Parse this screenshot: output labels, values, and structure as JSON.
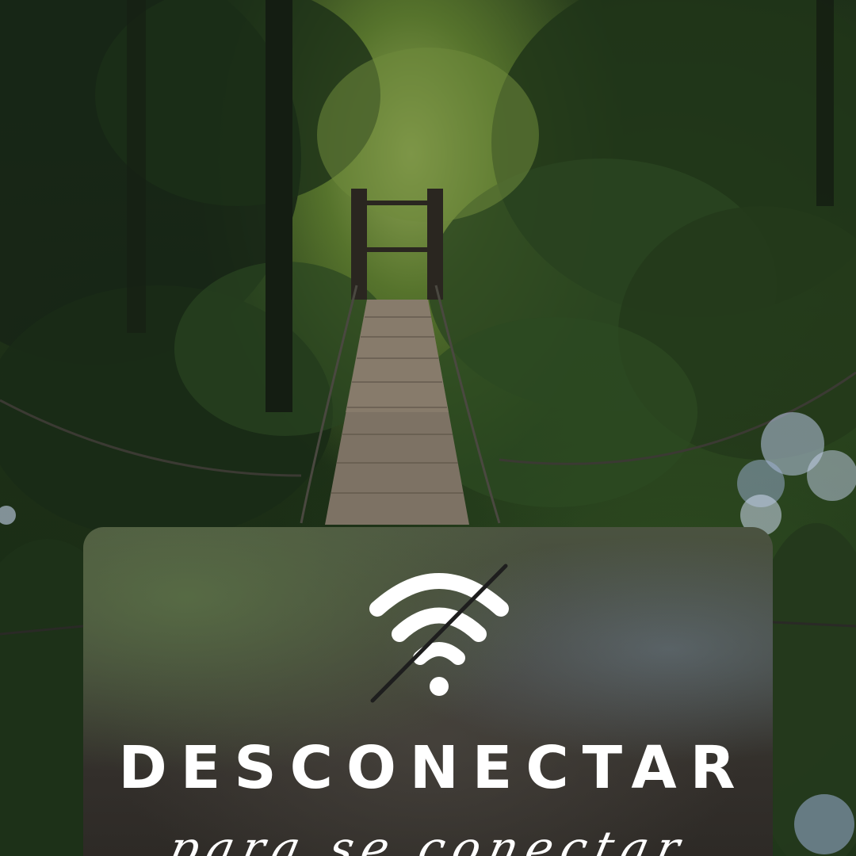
{
  "poster": {
    "headline": "DESCONECTAR",
    "tagline": "para se conectar"
  },
  "icons": {
    "main": "wifi-off-icon"
  },
  "colors": {
    "text": "#ffffff",
    "slash": "#1e1e1e",
    "forest_dark": "#142513",
    "forest_light": "#8fa455",
    "bridge_wood": "#8b7f6e",
    "hydrangea": "#b9c8e6"
  }
}
